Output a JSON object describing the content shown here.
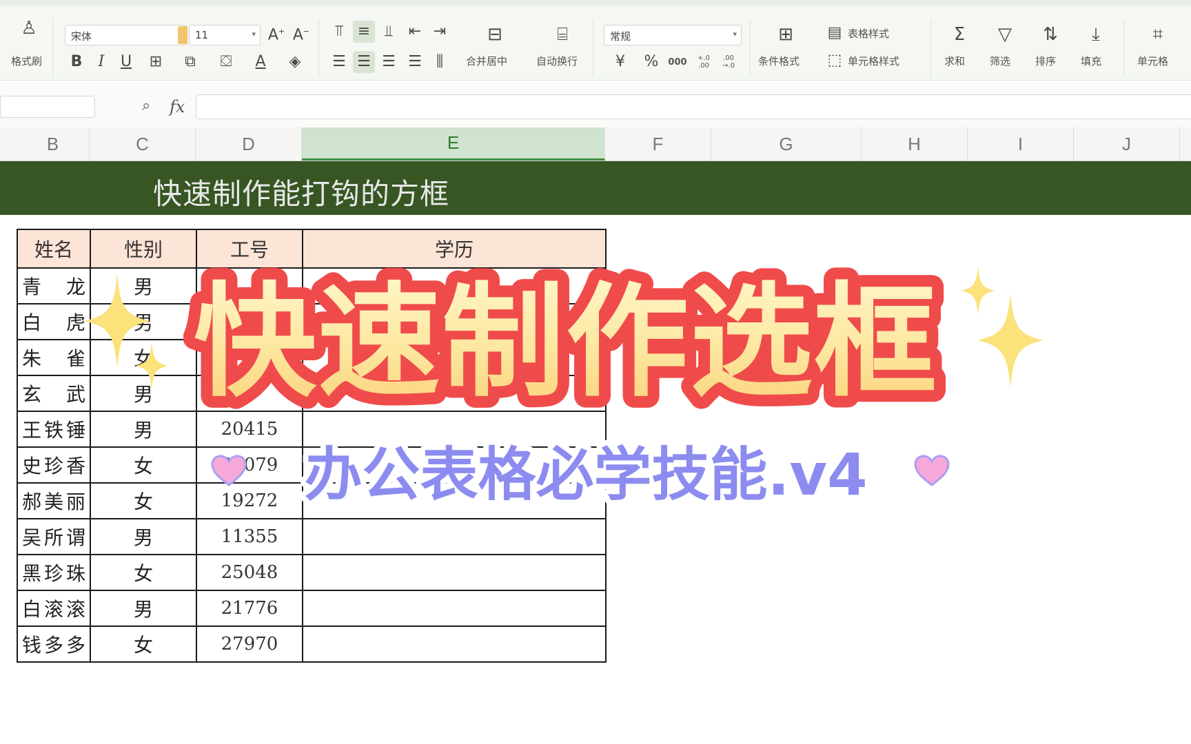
{
  "ribbon": {
    "font_name": "宋体",
    "font_size": "11",
    "number_format": "常规",
    "format_painter_label": "格式刷",
    "merge_center_label": "合并居中",
    "wrap_text_label": "自动换行",
    "cond_format_label": "条件格式",
    "table_style_label": "表格样式",
    "cell_style_label": "单元格样式",
    "sum_label": "求和",
    "filter_label": "筛选",
    "sort_label": "排序",
    "fill_label": "填充",
    "cells_label": "单元格",
    "currency_label": "¥",
    "percent_label": "%",
    "thousands_label": "000",
    "inc_decimal_label": "+.0 .00",
    "dec_decimal_label": ".00 →.0"
  },
  "formula_bar": {
    "name_box": "",
    "fx_label": "fx",
    "content": ""
  },
  "columns": [
    "B",
    "C",
    "D",
    "E",
    "F",
    "G",
    "H",
    "I",
    "J"
  ],
  "selected_column": "E",
  "banner_title": "快速制作能打钩的方框",
  "table": {
    "headers": [
      "姓名",
      "性别",
      "工号",
      "学历"
    ],
    "rows": [
      {
        "name": "青龙",
        "sex": "男",
        "id": "",
        "edu": ""
      },
      {
        "name": "白虎",
        "sex": "男",
        "id": "",
        "edu": ""
      },
      {
        "name": "朱雀",
        "sex": "女",
        "id": "",
        "edu": ""
      },
      {
        "name": "玄武",
        "sex": "男",
        "id": "",
        "edu": ""
      },
      {
        "name": "王铁锤",
        "sex": "男",
        "id": "20415",
        "edu": ""
      },
      {
        "name": "史珍香",
        "sex": "女",
        "id": "20079",
        "edu": ""
      },
      {
        "name": "郝美丽",
        "sex": "女",
        "id": "19272",
        "edu": ""
      },
      {
        "name": "吴所谓",
        "sex": "男",
        "id": "11355",
        "edu": ""
      },
      {
        "name": "黑珍珠",
        "sex": "女",
        "id": "25048",
        "edu": ""
      },
      {
        "name": "白滚滚",
        "sex": "男",
        "id": "21776",
        "edu": ""
      },
      {
        "name": "钱多多",
        "sex": "女",
        "id": "27970",
        "edu": ""
      }
    ]
  },
  "overlay": {
    "headline": "快速制作选框",
    "subline": "办公表格必学技能.v4"
  },
  "colors": {
    "banner": "#375623",
    "header_fill": "#fce4d6",
    "headline_outline": "#f04b4b",
    "sub_text": "#8c8cf0",
    "sparkle": "#fbe27a",
    "heart": "#f6a9d8"
  }
}
